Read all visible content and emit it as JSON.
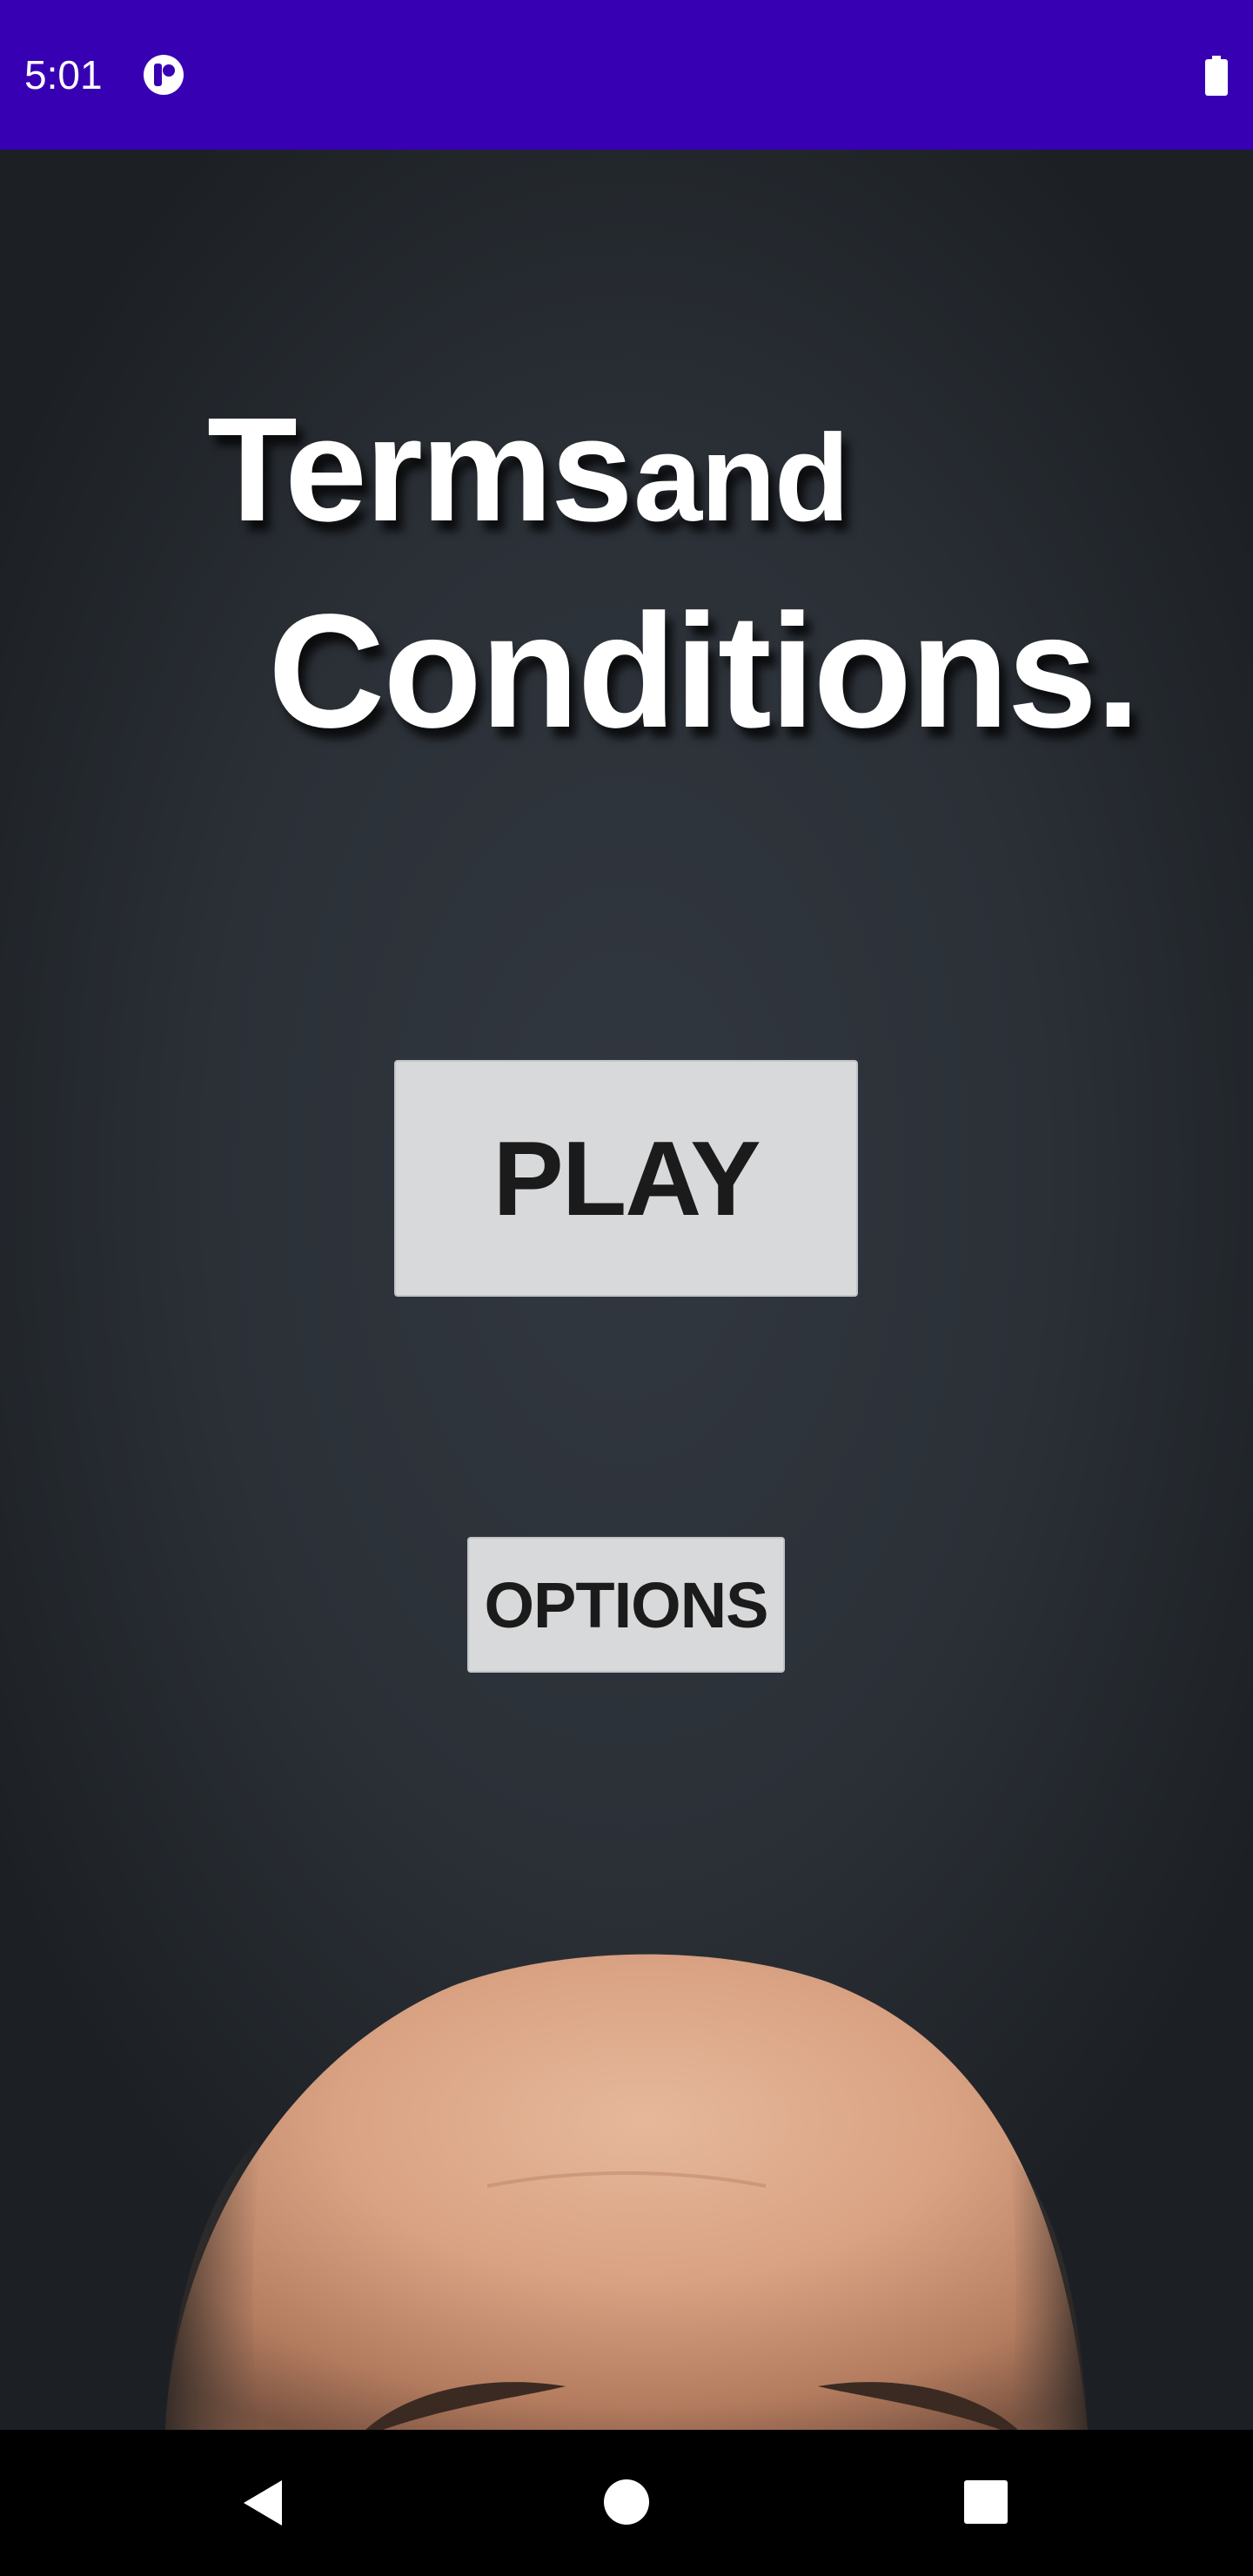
{
  "status_bar": {
    "time": "5:01",
    "background_color": "#3700b3",
    "app_icon": "notification-app-icon",
    "battery_icon": "battery-icon"
  },
  "game": {
    "title_word_1": "Terms",
    "title_word_2": "and",
    "title_line_2": "Conditions.",
    "play_label": "PLAY",
    "options_label": "OPTIONS",
    "button_color": "#d8d9da",
    "background_color": "#2b3037",
    "artwork": "bald-head-illustration"
  },
  "nav_bar": {
    "back_icon": "back-triangle-icon",
    "home_icon": "home-circle-icon",
    "recents_icon": "recents-square-icon"
  }
}
